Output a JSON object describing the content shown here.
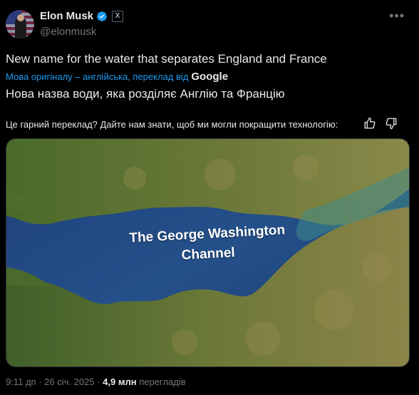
{
  "author": {
    "name": "Elon Musk",
    "handle": "@elonmusk",
    "verified": true,
    "affiliation_badge": "X"
  },
  "post": {
    "text_original": "New name for the water that separates England and France",
    "translation_note": "Мова оригіналу – англійська, переклад від",
    "translator": "Google",
    "text_translated": "Нова назва води, яка розділяє Англію та Францію",
    "feedback_prompt": "Це гарний переклад? Дайте нам знати, щоб ми могли покращити технологію:",
    "image_caption_line1": "The George Washington",
    "image_caption_line2": "Channel"
  },
  "meta": {
    "time": "9:11 дп",
    "separator1": "·",
    "date": "26 січ. 2025",
    "separator2": "·",
    "views_count": "4,9 млн",
    "views_label": "перегладів"
  },
  "icons": {
    "verified": "verified-badge-icon",
    "more": "more-options-icon",
    "thumbs_up": "thumbs-up-icon",
    "thumbs_down": "thumbs-down-icon"
  },
  "colors": {
    "background": "#000000",
    "text": "#e7e9ea",
    "secondary": "#71767b",
    "accent": "#1d9bf0"
  }
}
